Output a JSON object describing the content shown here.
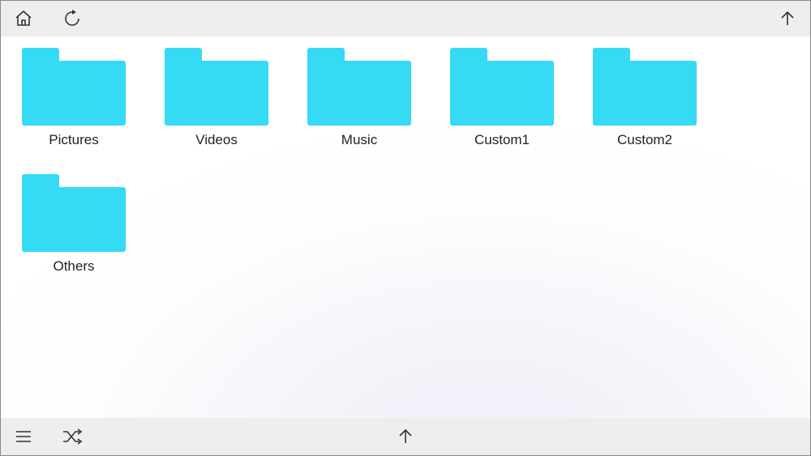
{
  "toolbar": {
    "home": "Home",
    "refresh": "Refresh",
    "up_top": "Up",
    "menu": "Menu",
    "shuffle": "Shuffle",
    "up_bottom": "Up"
  },
  "folders": [
    {
      "label": "Pictures"
    },
    {
      "label": "Videos"
    },
    {
      "label": "Music"
    },
    {
      "label": "Custom1"
    },
    {
      "label": "Custom2"
    },
    {
      "label": "Others"
    }
  ]
}
